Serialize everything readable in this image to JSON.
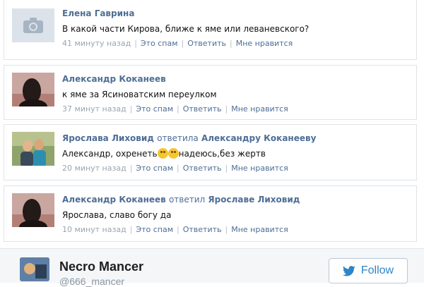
{
  "comments": [
    {
      "author": "Елена Гаврина",
      "text": "В какой части Кирова, ближе к яме или леваневского?",
      "time": "41 минуту назад",
      "actions": {
        "spam": "Это спам",
        "reply": "Ответить",
        "like": "Мне нравится"
      },
      "avatar": "camera-icon"
    },
    {
      "author": "Александр Коканеев",
      "text": "к яме за Ясиноватским переулком",
      "time": "37 минут назад",
      "actions": {
        "spam": "Это спам",
        "reply": "Ответить",
        "like": "Мне нравится"
      },
      "avatar": "photo"
    },
    {
      "author": "Ярослава Лиховид",
      "replied_word": "ответила",
      "replied_to": "Александру Коканееву",
      "text_before": "Александр, охренеть",
      "text_after": "надеюсь,без жертв",
      "time": "20 минут назад",
      "actions": {
        "spam": "Это спам",
        "reply": "Ответить",
        "like": "Мне нравится"
      },
      "avatar": "photo"
    },
    {
      "author": "Александр Коканеев",
      "replied_word": "ответил",
      "replied_to": "Ярославе Лиховид",
      "text": "Ярослава, славо богу да",
      "time": "10 минут назад",
      "actions": {
        "spam": "Это спам",
        "reply": "Ответить",
        "like": "Мне нравится"
      },
      "avatar": "photo"
    }
  ],
  "tweet_user": {
    "name": "Necro Mancer",
    "handle": "@666_mancer",
    "follow_label": "Follow"
  },
  "colors": {
    "link": "#4e6e96",
    "meta": "#9aa5b1",
    "twitter": "#2e85c8"
  }
}
